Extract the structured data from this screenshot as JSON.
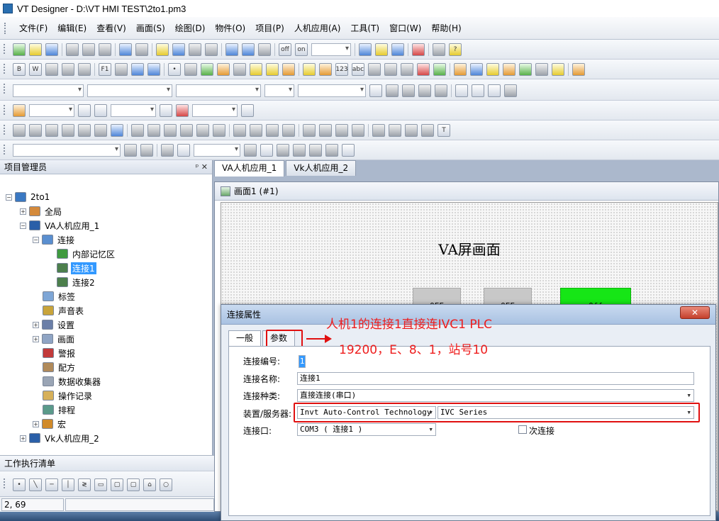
{
  "window": {
    "title": "VT Designer - D:\\VT HMI TEST\\2to1.pm3"
  },
  "menu": [
    "文件(F)",
    "编辑(E)",
    "查看(V)",
    "画面(S)",
    "绘图(D)",
    "物件(O)",
    "项目(P)",
    "人机应用(A)",
    "工具(T)",
    "窗口(W)",
    "帮助(H)"
  ],
  "toolbar": {
    "off_label": "off",
    "on_label": "on"
  },
  "project_panel": {
    "title": "项目管理员",
    "pin": "ᵖ ✕",
    "tree": {
      "root": "2to1",
      "global": "全局",
      "va_app": "VA人机应用_1",
      "connection": "连接",
      "internal_memory": "内部记忆区",
      "conn1": "连接1",
      "conn2": "连接2",
      "tags": "标签",
      "sound_table": "声音表",
      "settings": "设置",
      "screens": "画面",
      "alarm": "警报",
      "recipe": "配方",
      "data_collector": "数据收集器",
      "operation_log": "操作记录",
      "schedule": "排程",
      "macro": "宏",
      "vk_app": "Vk人机应用_2"
    }
  },
  "worklist": {
    "title": "工作执行清单"
  },
  "status": {
    "position": "2, 69"
  },
  "doc_tabs": [
    "VA人机应用_1",
    "Vk人机应用_2"
  ],
  "screen_window": {
    "title": "画面1 (#1)",
    "heading": "VA屏画面",
    "switches": [
      "OFF",
      "OFF",
      "Off"
    ]
  },
  "dialog": {
    "title": "连接属性",
    "close": "✕",
    "tabs": {
      "general": "一般",
      "params": "参数"
    },
    "labels": {
      "conn_number": "连接编号:",
      "conn_name": "连接名称:",
      "conn_type": "连接种类:",
      "device": "装置/服务器:",
      "port": "连接口:",
      "secondary": "次连接"
    },
    "values": {
      "conn_number": "1",
      "conn_name": "连接1",
      "conn_type": "直接连接(串口)",
      "vendor": "Invt Auto-Control Technology",
      "series": "IVC Series",
      "port": "COM3 ( 连接1 )"
    }
  },
  "annotation": {
    "line1": "人机1的连接1直接连IVC1 PLC",
    "line2": "19200，E、8、1，站号10"
  },
  "colors": {
    "highlight": "#e01010",
    "annotation": "#ee1d1d",
    "on_switch": "#16e616",
    "selected": "#3399ff"
  }
}
